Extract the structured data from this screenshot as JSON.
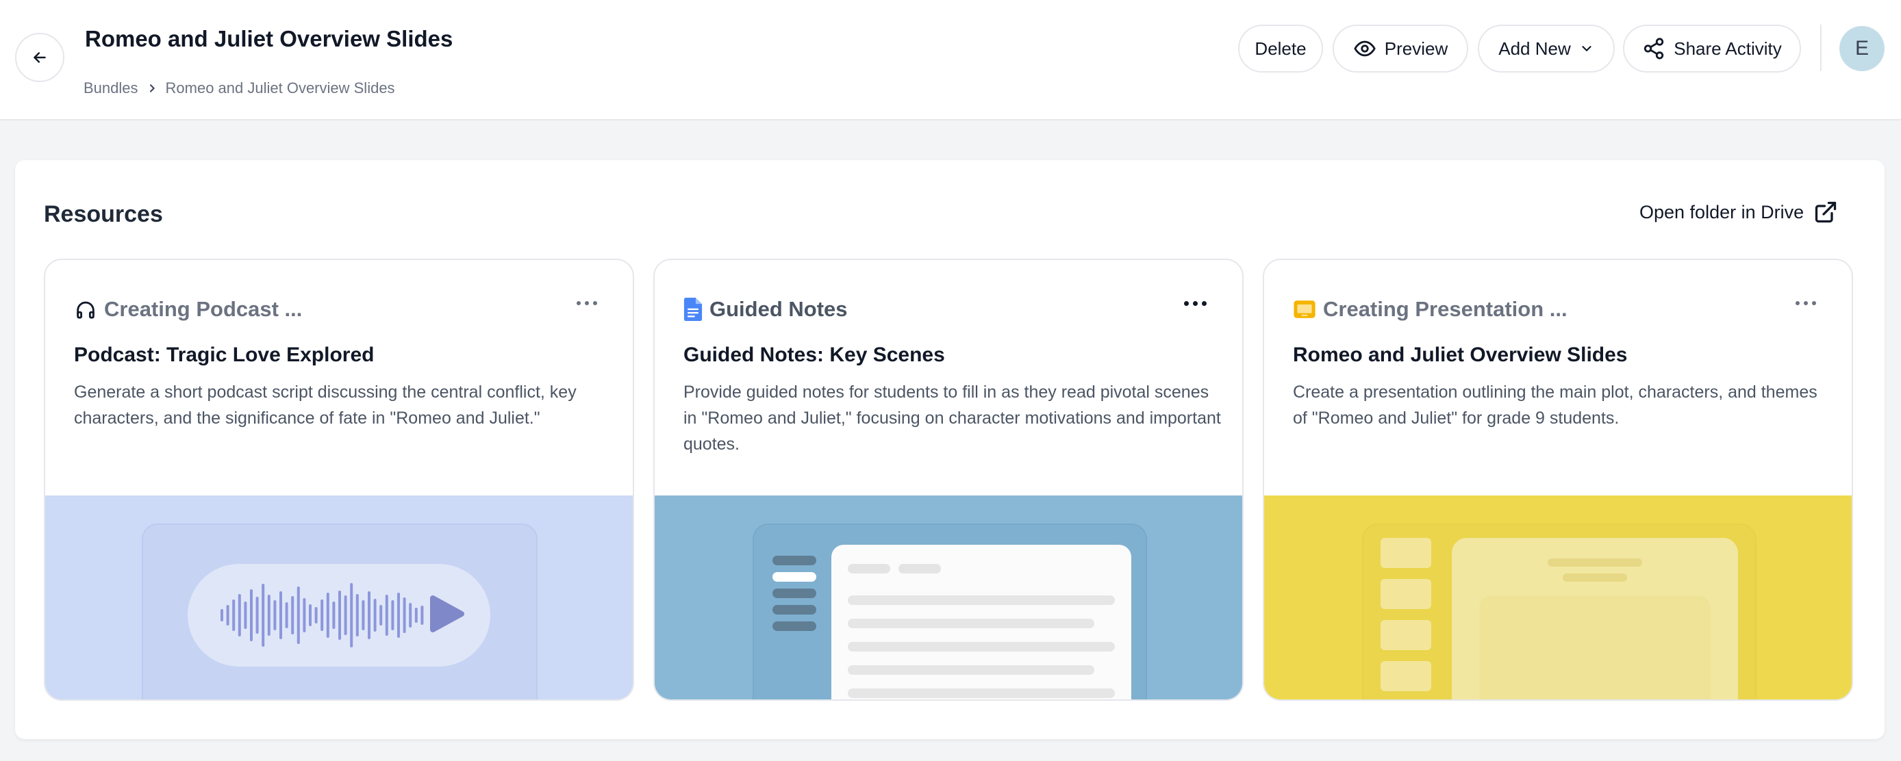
{
  "header": {
    "title": "Romeo and Juliet Overview Slides",
    "breadcrumb": [
      "Bundles",
      "Romeo and Juliet Overview Slides"
    ],
    "buttons": {
      "delete": "Delete",
      "preview": "Preview",
      "add_new": "Add New",
      "share": "Share Activity"
    },
    "avatar_initial": "E"
  },
  "panel": {
    "title": "Resources",
    "open_drive": "Open folder in Drive"
  },
  "cards": [
    {
      "type_label": "Creating Podcast ...",
      "type_icon": "headphones-icon",
      "title": "Podcast: Tragic Love Explored",
      "description": "Generate a short podcast script discussing the central conflict, key characters, and the significance of fate in \"Romeo and Juliet.\"",
      "image_bg": "#ccd9f7"
    },
    {
      "type_label": "Guided Notes",
      "type_icon": "google-docs-icon",
      "title": "Guided Notes: Key Scenes",
      "description": "Provide guided notes for students to fill in as they read pivotal scenes in \"Romeo and Juliet,\" focusing on character motivations and important quotes.",
      "image_bg": "#89b8d7"
    },
    {
      "type_label": "Creating Presentation ...",
      "type_icon": "google-slides-icon",
      "title": "Romeo and Juliet Overview Slides",
      "description": "Create a presentation outlining the main plot, characters, and themes of \"Romeo and Juliet\" for grade 9 students.",
      "image_bg": "#eed94e"
    }
  ],
  "colors": {
    "accent_docs": "#4a86f7",
    "accent_slides": "#f4b400"
  }
}
